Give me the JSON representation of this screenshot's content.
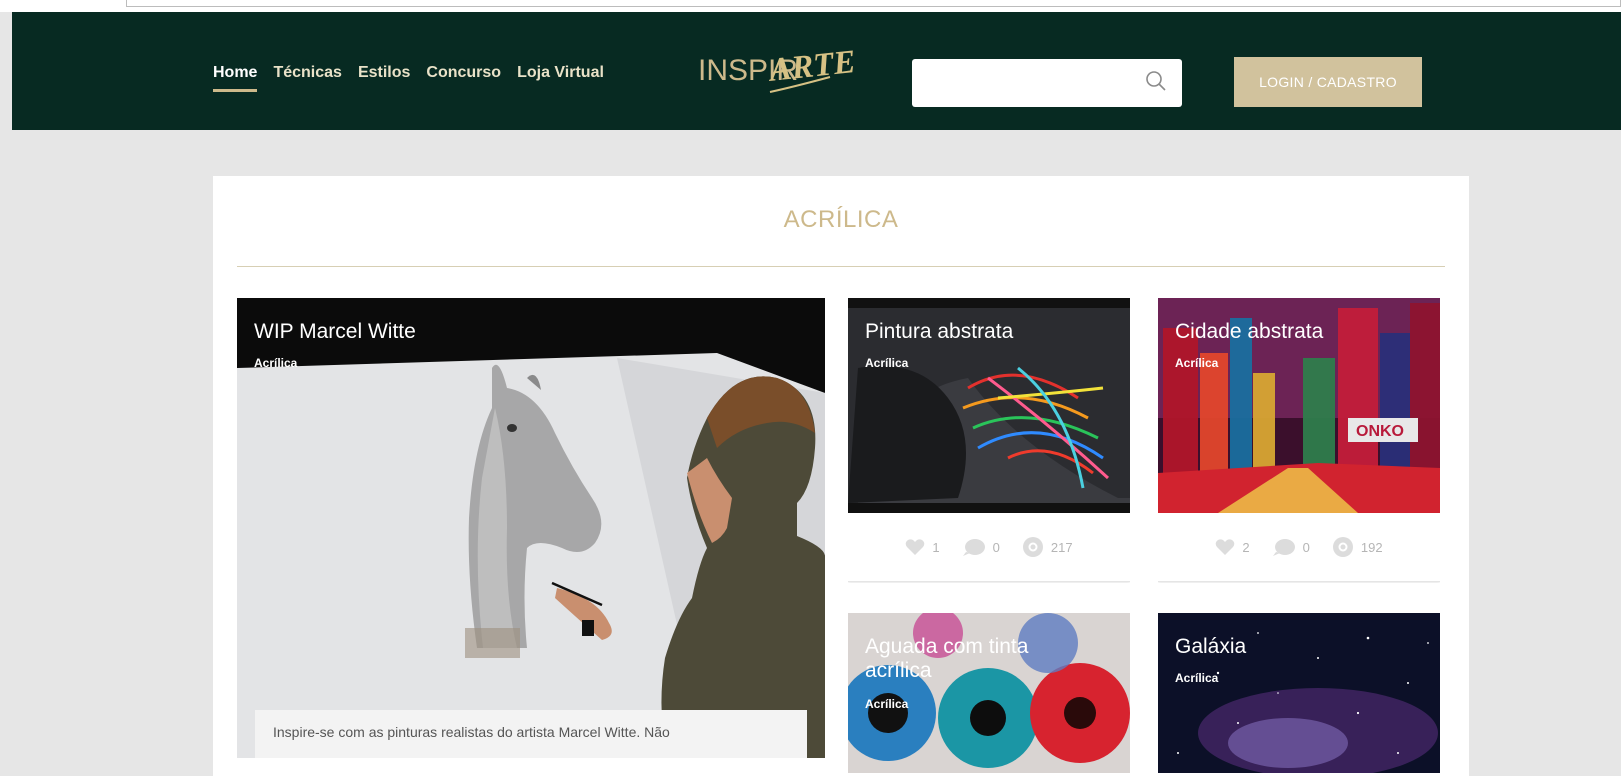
{
  "nav": {
    "items": [
      {
        "label": "Home",
        "active": true
      },
      {
        "label": "Técnicas"
      },
      {
        "label": "Estilos"
      },
      {
        "label": "Concurso"
      },
      {
        "label": "Loja Virtual"
      }
    ]
  },
  "logo": {
    "part1": "INSPIR",
    "part2": "ARTE"
  },
  "search": {
    "placeholder": ""
  },
  "login_label": "LOGIN / CADASTRO",
  "page_title": "ACRÍLICA",
  "feature": {
    "title": "WIP Marcel Witte",
    "category": "Acrílica",
    "excerpt": "Inspire-se com as pinturas realistas do artista Marcel Witte. Não"
  },
  "cards": [
    {
      "title": "Pintura abstrata",
      "category": "Acrílica",
      "likes": "1",
      "comments": "0",
      "views": "217"
    },
    {
      "title": "Cidade abstrata",
      "category": "Acrílica",
      "likes": "2",
      "comments": "0",
      "views": "192"
    },
    {
      "title": "Aguada com tinta acrílica",
      "category": "Acrílica"
    },
    {
      "title": "Galáxia",
      "category": "Acrílica"
    }
  ],
  "colors": {
    "header_bg": "#072a22",
    "accent": "#cdb98b",
    "login_bg": "#d1c29d",
    "page_bg": "#e6e6e6"
  }
}
